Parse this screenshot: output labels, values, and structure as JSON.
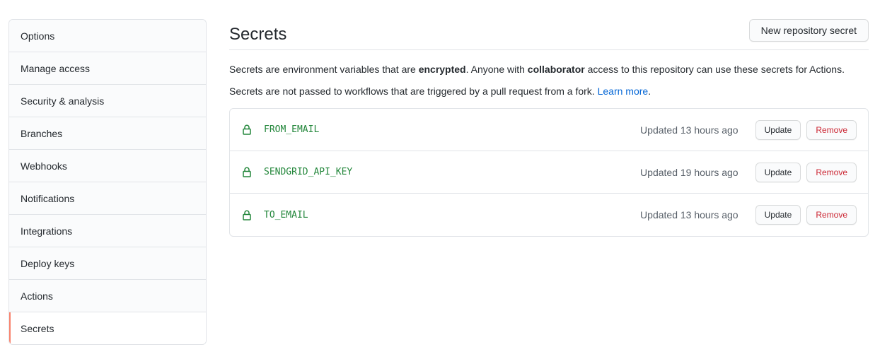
{
  "sidebar": {
    "items": [
      {
        "label": "Options"
      },
      {
        "label": "Manage access"
      },
      {
        "label": "Security & analysis"
      },
      {
        "label": "Branches"
      },
      {
        "label": "Webhooks"
      },
      {
        "label": "Notifications"
      },
      {
        "label": "Integrations"
      },
      {
        "label": "Deploy keys"
      },
      {
        "label": "Actions"
      },
      {
        "label": "Secrets",
        "selected": true
      }
    ]
  },
  "header": {
    "title": "Secrets",
    "new_button_label": "New repository secret"
  },
  "description": {
    "line1_a": "Secrets are environment variables that are ",
    "line1_b": "encrypted",
    "line1_c": ". Anyone with ",
    "line1_d": "collaborator",
    "line1_e": " access to this repository can use these secrets for Actions.",
    "line2_a": "Secrets are not passed to workflows that are triggered by a pull request from a fork. ",
    "line2_link": "Learn more",
    "line2_end": "."
  },
  "secrets": [
    {
      "name": "FROM_EMAIL",
      "updated": "Updated 13 hours ago",
      "update_label": "Update",
      "remove_label": "Remove"
    },
    {
      "name": "SENDGRID_API_KEY",
      "updated": "Updated 19 hours ago",
      "update_label": "Update",
      "remove_label": "Remove"
    },
    {
      "name": "TO_EMAIL",
      "updated": "Updated 13 hours ago",
      "update_label": "Update",
      "remove_label": "Remove"
    }
  ],
  "icons": {
    "secret_icon": "lock-icon"
  },
  "colors": {
    "accent_selected": "#f9826c",
    "secret_name": "#22863a",
    "link": "#0366d6",
    "remove": "#cb2431"
  }
}
